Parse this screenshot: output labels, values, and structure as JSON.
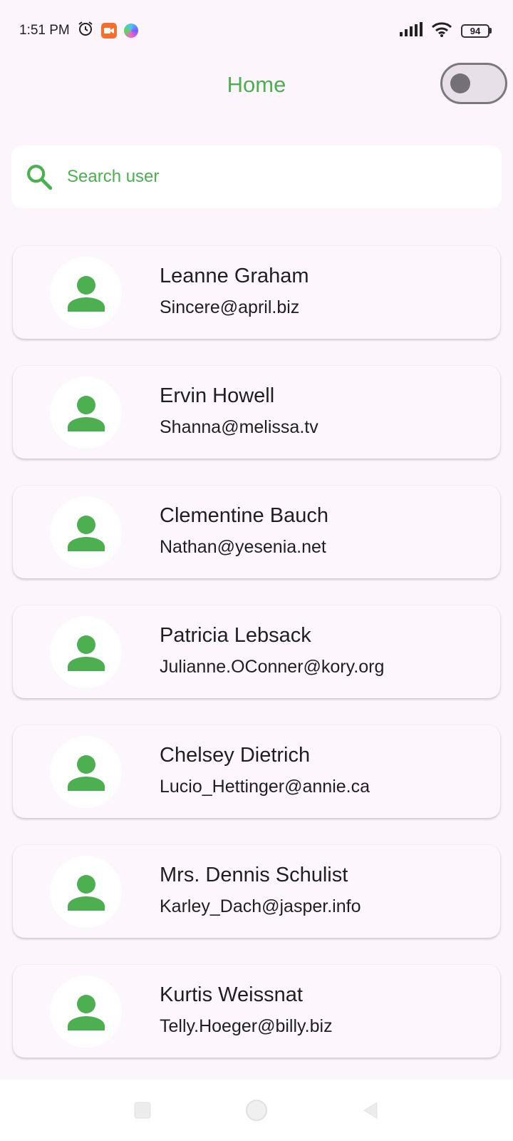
{
  "status_bar": {
    "time": "1:51 PM",
    "battery_level": "94",
    "icons": [
      "alarm-icon",
      "video-notification-icon",
      "assistant-icon",
      "signal-icon",
      "wifi-icon",
      "battery-icon"
    ]
  },
  "app_bar": {
    "title": "Home",
    "theme_toggle_on": false
  },
  "search": {
    "placeholder": "Search user",
    "value": ""
  },
  "colors": {
    "accent": "#4caf50",
    "background": "#fcf6fc",
    "card": "#fdf7fd"
  },
  "users": [
    {
      "name": "Leanne Graham",
      "email": "Sincere@april.biz"
    },
    {
      "name": "Ervin Howell",
      "email": "Shanna@melissa.tv"
    },
    {
      "name": "Clementine Bauch",
      "email": "Nathan@yesenia.net"
    },
    {
      "name": "Patricia Lebsack",
      "email": "Julianne.OConner@kory.org"
    },
    {
      "name": "Chelsey Dietrich",
      "email": "Lucio_Hettinger@annie.ca"
    },
    {
      "name": "Mrs. Dennis Schulist",
      "email": "Karley_Dach@jasper.info"
    },
    {
      "name": "Kurtis Weissnat",
      "email": "Telly.Hoeger@billy.biz"
    }
  ],
  "nav_bar": {
    "buttons": [
      "recents-icon",
      "home-icon",
      "back-icon"
    ]
  }
}
